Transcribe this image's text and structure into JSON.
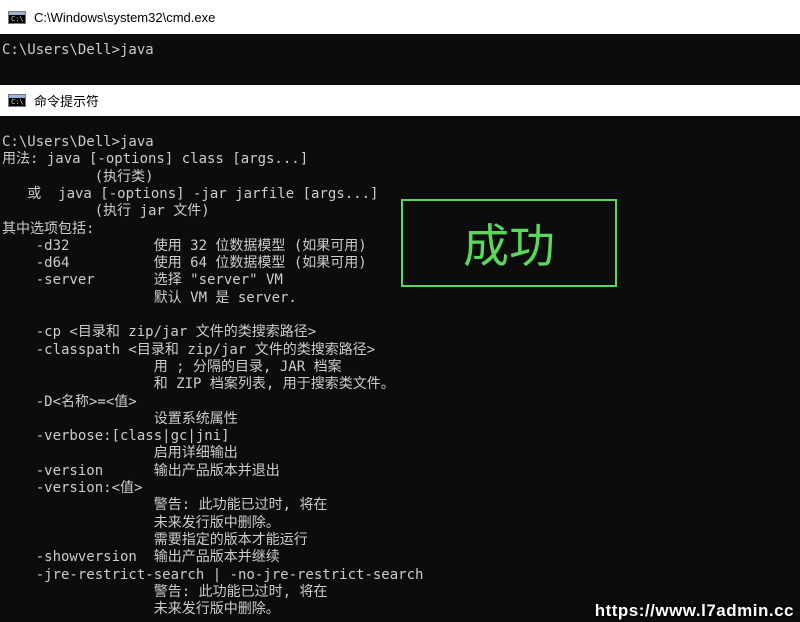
{
  "window1": {
    "title": "C:\\Windows\\system32\\cmd.exe",
    "icon_label": "C:\\",
    "lines": [
      "C:\\Users\\Dell>java"
    ]
  },
  "window2": {
    "title": "命令提示符",
    "icon_label": "C:\\",
    "lines": [
      "C:\\Users\\Dell>java",
      "用法: java [-options] class [args...]",
      "           (执行类)",
      "   或  java [-options] -jar jarfile [args...]",
      "           (执行 jar 文件)",
      "其中选项包括:",
      "    -d32          使用 32 位数据模型 (如果可用)",
      "    -d64          使用 64 位数据模型 (如果可用)",
      "    -server       选择 \"server\" VM",
      "                  默认 VM 是 server.",
      "",
      "    -cp <目录和 zip/jar 文件的类搜索路径>",
      "    -classpath <目录和 zip/jar 文件的类搜索路径>",
      "                  用 ; 分隔的目录, JAR 档案",
      "                  和 ZIP 档案列表, 用于搜索类文件。",
      "    -D<名称>=<值>",
      "                  设置系统属性",
      "    -verbose:[class|gc|jni]",
      "                  启用详细输出",
      "    -version      输出产品版本并退出",
      "    -version:<值>",
      "                  警告: 此功能已过时, 将在",
      "                  未来发行版中删除。",
      "                  需要指定的版本才能运行",
      "    -showversion  输出产品版本并继续",
      "    -jre-restrict-search | -no-jre-restrict-search",
      "                  警告: 此功能已过时, 将在",
      "                  未来发行版中删除。"
    ]
  },
  "annotation": {
    "text": "成功",
    "color": "#59d85b"
  },
  "watermark": {
    "text": "https://www.l7admin.cc"
  },
  "colors": {
    "terminal_bg": "#0c0c0c",
    "terminal_text": "#cccccc",
    "titlebar_bg": "#ffffff"
  }
}
